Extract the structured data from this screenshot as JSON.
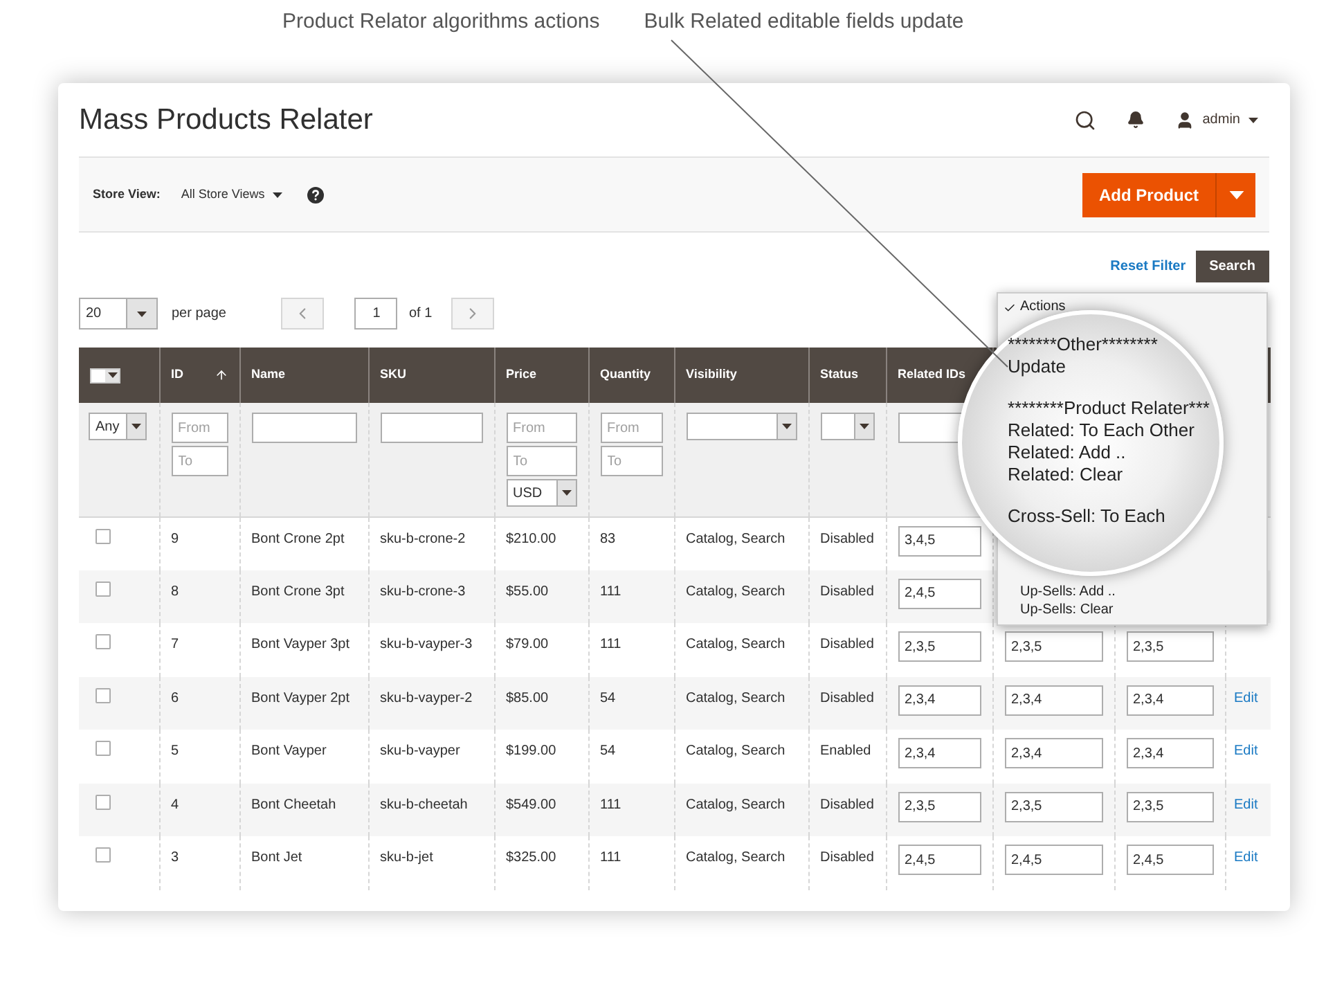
{
  "annotations": [
    {
      "text": "Product Relator algorithms actions"
    },
    {
      "text": "Bulk Related editable fields update"
    }
  ],
  "header": {
    "title": "Mass Products Relater",
    "user": "admin"
  },
  "toolbar": {
    "store_view_label": "Store View:",
    "store_view_value": "All Store Views",
    "add_button": "Add Product"
  },
  "grid_actions": {
    "reset": "Reset Filter",
    "search": "Search"
  },
  "pagination": {
    "per_page_value": "20",
    "per_page_label": "per page",
    "page": "1",
    "of": "of 1"
  },
  "table": {
    "columns": [
      {
        "label": "ID",
        "sorted": true
      },
      {
        "label": "Name",
        "sorted": false
      },
      {
        "label": "SKU",
        "sorted": false
      },
      {
        "label": "Price",
        "sorted": false
      },
      {
        "label": "Quantity",
        "sorted": false
      },
      {
        "label": "Visibility",
        "sorted": false
      },
      {
        "label": "Status",
        "sorted": false
      },
      {
        "label": "Related IDs",
        "sorted": false
      }
    ],
    "filters": {
      "any": "Any",
      "id_from": {
        "placeholder": "From"
      },
      "id_to": {
        "placeholder": "To"
      },
      "price_from": {
        "placeholder": "From"
      },
      "price_to": {
        "placeholder": "To"
      },
      "currency": "USD",
      "qty_from": {
        "placeholder": "From"
      },
      "qty_to": {
        "placeholder": "To"
      }
    },
    "rows": [
      {
        "checked": false,
        "id": "9",
        "name": "Bont Crone 2pt",
        "sku": "sku-b-crone-2",
        "price": "$210.00",
        "quantity": "83",
        "visibility": "Catalog, Search",
        "status": "Disabled",
        "related": "3,4,5"
      },
      {
        "checked": false,
        "id": "8",
        "name": "Bont Crone 3pt",
        "sku": "sku-b-crone-3",
        "price": "$55.00",
        "quantity": "111",
        "visibility": "Catalog, Search",
        "status": "Disabled",
        "related": "2,4,5"
      },
      {
        "checked": false,
        "id": "7",
        "name": "Bont Vayper 3pt",
        "sku": "sku-b-vayper-3",
        "price": "$79.00",
        "quantity": "111",
        "visibility": "Catalog, Search",
        "status": "Disabled",
        "related": "2,3,5",
        "cross_sell": "2,3,5",
        "up_sell": "2,3,5"
      },
      {
        "checked": false,
        "id": "6",
        "name": "Bont Vayper 2pt",
        "sku": "sku-b-vayper-2",
        "price": "$85.00",
        "quantity": "54",
        "visibility": "Catalog, Search",
        "status": "Disabled",
        "related": "2,3,4",
        "cross_sell": "2,3,4",
        "up_sell": "2,3,4",
        "action": "Edit"
      },
      {
        "checked": false,
        "id": "5",
        "name": "Bont Vayper",
        "sku": "sku-b-vayper",
        "price": "$199.00",
        "quantity": "54",
        "visibility": "Catalog, Search",
        "status": "Enabled",
        "related": "2,3,4",
        "cross_sell": "2,3,4",
        "up_sell": "2,3,4",
        "action": "Edit"
      },
      {
        "checked": false,
        "id": "4",
        "name": "Bont Cheetah",
        "sku": "sku-b-cheetah",
        "price": "$549.00",
        "quantity": "111",
        "visibility": "Catalog, Search",
        "status": "Disabled",
        "related": "2,3,5",
        "cross_sell": "2,3,5",
        "up_sell": "2,3,5",
        "action": "Edit"
      },
      {
        "checked": false,
        "id": "3",
        "name": "Bont Jet",
        "sku": "sku-b-jet",
        "price": "$325.00",
        "quantity": "111",
        "visibility": "Catalog, Search",
        "status": "Disabled",
        "related": "2,4,5",
        "cross_sell": "2,4,5",
        "up_sell": "2,4,5",
        "action": "Edit"
      }
    ]
  },
  "actions_menu": {
    "items": [
      {
        "text": "Actions",
        "kind": "small",
        "selected": true
      },
      {
        "text": "*******Other********",
        "kind": "zoom",
        "selected": false
      },
      {
        "text": "Update",
        "kind": "zoom",
        "selected": false
      },
      {
        "text": "********Product Relater***",
        "kind": "zoom",
        "gap": true,
        "selected": false
      },
      {
        "text": "Related: To Each Other",
        "kind": "zoom",
        "selected": false
      },
      {
        "text": "Related: Add ..",
        "kind": "zoom",
        "selected": false
      },
      {
        "text": "Related: Clear",
        "kind": "zoom",
        "selected": false
      },
      {
        "text": "Cross-Sell: To Each",
        "kind": "zoom",
        "gap": true,
        "selected": false
      },
      {
        "text": "Up-Sells: Add ..",
        "kind": "small",
        "selected": false
      },
      {
        "text": "Up-Sells: Clear",
        "kind": "small",
        "selected": false
      }
    ]
  }
}
